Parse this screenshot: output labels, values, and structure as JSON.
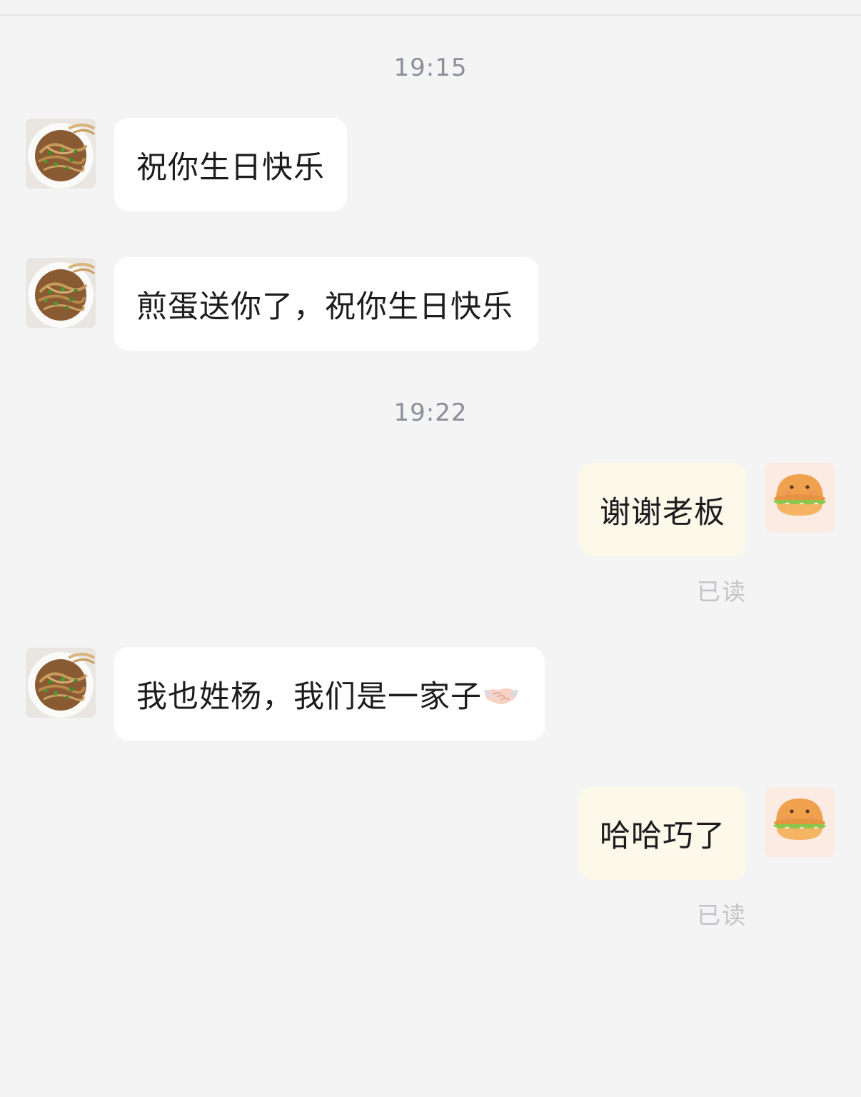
{
  "chat": {
    "timestamps": [
      "19:15",
      "19:22"
    ],
    "messages": [
      {
        "sender": "contact",
        "text": "祝你生日快乐"
      },
      {
        "sender": "contact",
        "text": "煎蛋送你了，祝你生日快乐"
      },
      {
        "sender": "me",
        "text": "谢谢老板",
        "status": "已读"
      },
      {
        "sender": "contact",
        "text": "我也姓杨，我们是一家子",
        "emoji": "handshake-icon"
      },
      {
        "sender": "me",
        "text": "哈哈巧了",
        "status": "已读"
      }
    ]
  },
  "avatars": {
    "contact": "noodle-bowl-avatar",
    "me": "burger-avatar"
  },
  "colors": {
    "background": "#f4f4f4",
    "incoming_bubble": "#ffffff",
    "outgoing_bubble": "#fcf8ea",
    "timestamp": "#8a8f99",
    "read_receipt": "#c4c4c8"
  }
}
